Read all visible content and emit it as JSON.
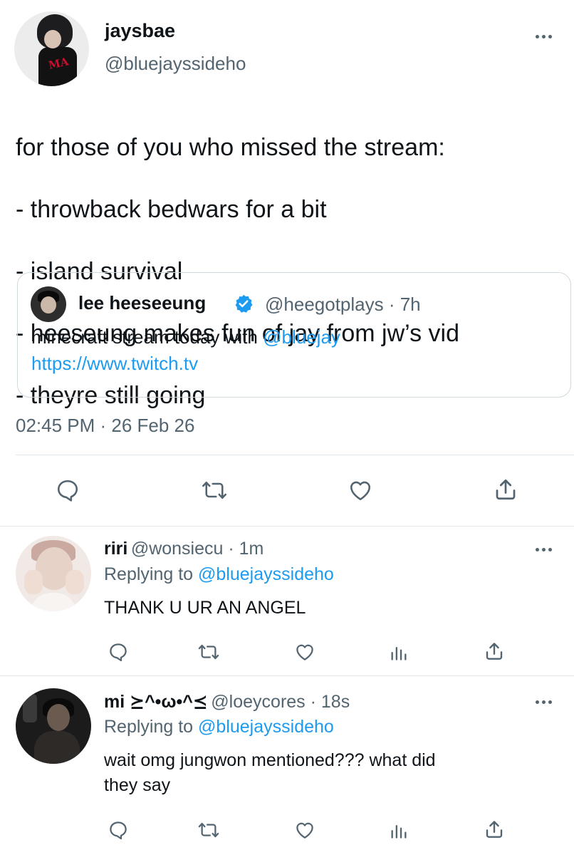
{
  "tweet": {
    "author_name": "jaysbae",
    "author_handle": "@bluejayssideho",
    "text_lines": [
      "for those of you who missed the stream:",
      "- throwback bedwars for a bit",
      "- island survival",
      "- heeseung makes fun of jay from jw’s vid",
      "- theyre still going"
    ],
    "timestamp": "02:45 PM · 26 Feb 26",
    "quote": {
      "name": "lee heeseeung",
      "meta": "@heegotplays · 7h",
      "text_prefix": "minecraft stream today with ",
      "mention": "@bluejay",
      "url": "https://www.twitch.tv"
    }
  },
  "replies": [
    {
      "name": "riri",
      "meta": "@wonsiecu · 1m",
      "replying_prefix": "Replying to ",
      "replying_to": "@bluejayssideho",
      "text_lines": [
        "THANK U UR AN ANGEL"
      ]
    },
    {
      "name": "mi ⪰^•ω•^⪯",
      "meta": "@loeycores · 18s",
      "replying_prefix": "Replying to ",
      "replying_to": "@bluejayssideho",
      "text_lines": [
        "wait omg jungwon mentioned??? what did",
        "they say"
      ]
    }
  ],
  "icons": {
    "reply": "reply-icon",
    "retweet": "retweet-icon",
    "like": "heart-icon",
    "share": "share-icon",
    "analytics": "analytics-icon",
    "more": "more-icon",
    "verified": "verified-badge-icon"
  },
  "colors": {
    "link": "#1d9bf0",
    "secondary_text": "#536471",
    "primary_text": "#0f1419",
    "border": "#cfd9de"
  }
}
